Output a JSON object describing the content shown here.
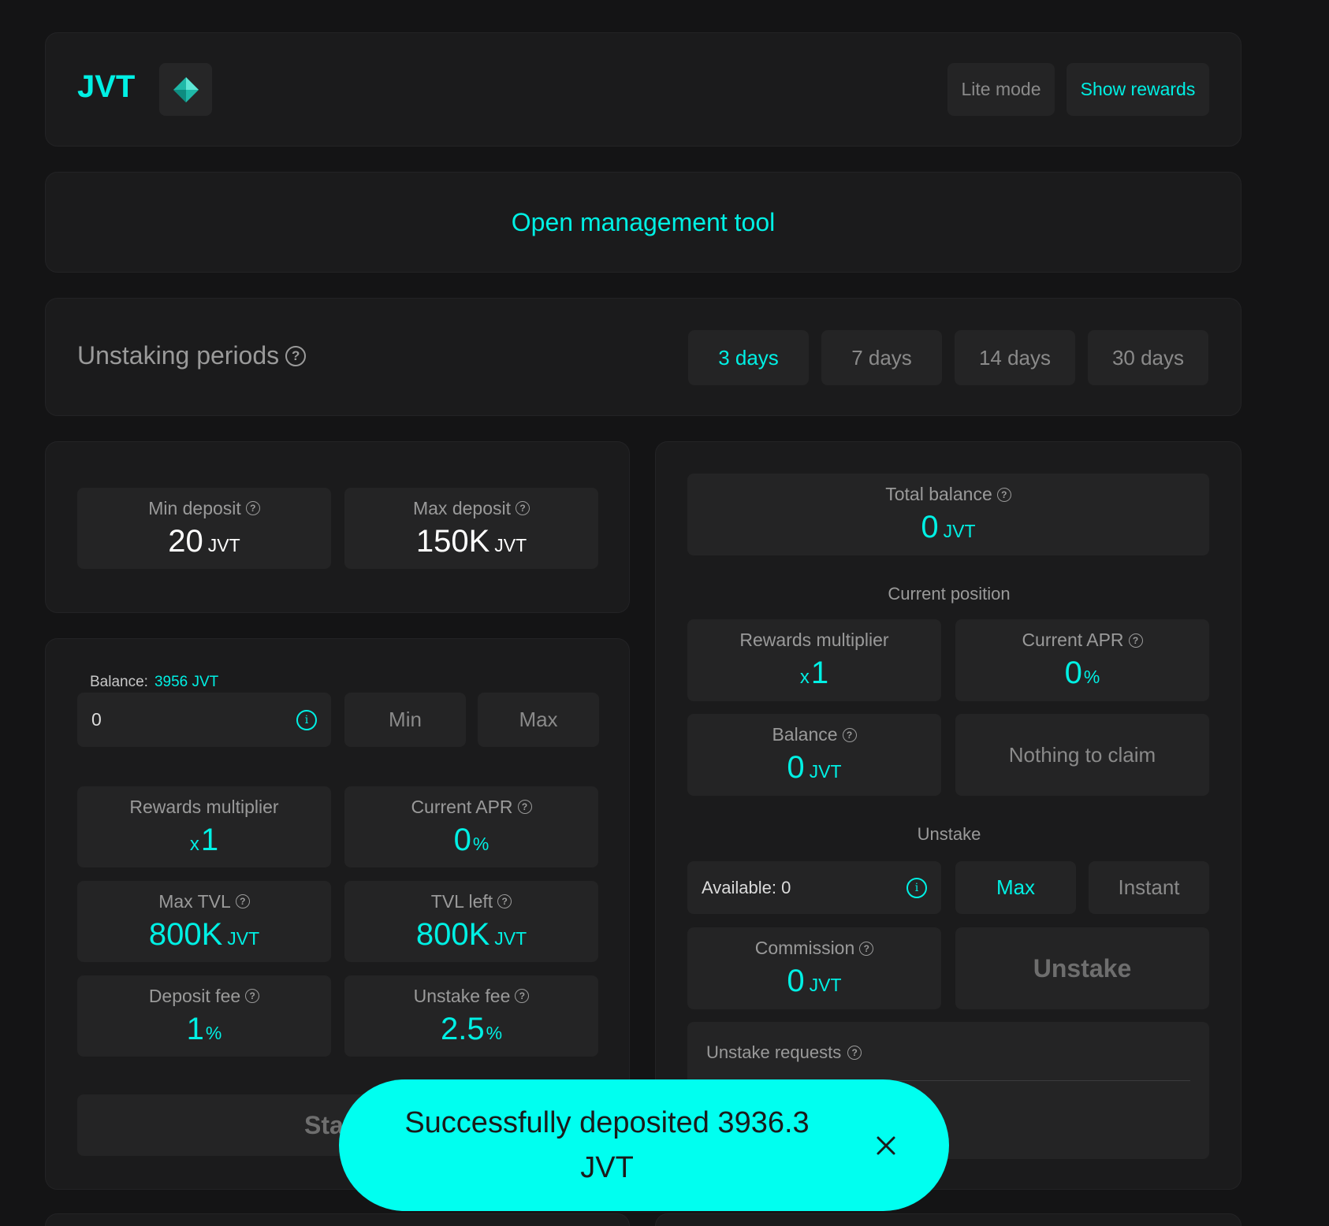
{
  "header": {
    "token": "JVT",
    "token_icon": "diamond-icon",
    "lite_mode_label": "Lite mode",
    "show_rewards_label": "Show rewards"
  },
  "management": {
    "open_tool_label": "Open management tool"
  },
  "unstaking_periods": {
    "title": "Unstaking periods",
    "options": [
      "3 days",
      "7 days",
      "14 days",
      "30 days"
    ],
    "selected": "3 days"
  },
  "deposit_limits": {
    "min": {
      "label": "Min deposit",
      "value": "20",
      "unit": "JVT"
    },
    "max": {
      "label": "Max deposit",
      "value": "150K",
      "unit": "JVT"
    }
  },
  "stake": {
    "balance_label": "Balance:",
    "balance_value": "3956 JVT",
    "amount_value": "0",
    "min_label": "Min",
    "max_label": "Max",
    "rewards_multiplier": {
      "label": "Rewards multiplier",
      "prefix": "x",
      "value": "1"
    },
    "current_apr": {
      "label": "Current APR",
      "value": "0",
      "unit": "%"
    },
    "max_tvl": {
      "label": "Max TVL",
      "value": "800K",
      "unit": "JVT"
    },
    "tvl_left": {
      "label": "TVL left",
      "value": "800K",
      "unit": "JVT"
    },
    "deposit_fee": {
      "label": "Deposit fee",
      "value": "1",
      "unit": "%"
    },
    "unstake_fee": {
      "label": "Unstake fee",
      "value": "2.5",
      "unit": "%"
    },
    "stake_button_label": "Sta"
  },
  "position": {
    "total_balance": {
      "label": "Total balance",
      "value": "0",
      "unit": "JVT"
    },
    "current_position_title": "Current position",
    "rewards_multiplier": {
      "label": "Rewards multiplier",
      "prefix": "x",
      "value": "1"
    },
    "current_apr": {
      "label": "Current APR",
      "value": "0",
      "unit": "%"
    },
    "balance": {
      "label": "Balance",
      "value": "0",
      "unit": "JVT"
    },
    "claim_label": "Nothing to claim",
    "unstake_title": "Unstake",
    "available_label": "Available: 0",
    "max_label": "Max",
    "instant_label": "Instant",
    "commission": {
      "label": "Commission",
      "value": "0",
      "unit": "JVT"
    },
    "unstake_button_label": "Unstake",
    "unstake_requests_label": "Unstake requests"
  },
  "toast": {
    "message_line1": "Successfully deposited 3936.3",
    "message_line2": "JVT",
    "close_icon": "close-icon"
  },
  "colors": {
    "accent": "#00f0e4",
    "background": "#141415",
    "card": "#1b1b1c",
    "tile": "#242425"
  }
}
